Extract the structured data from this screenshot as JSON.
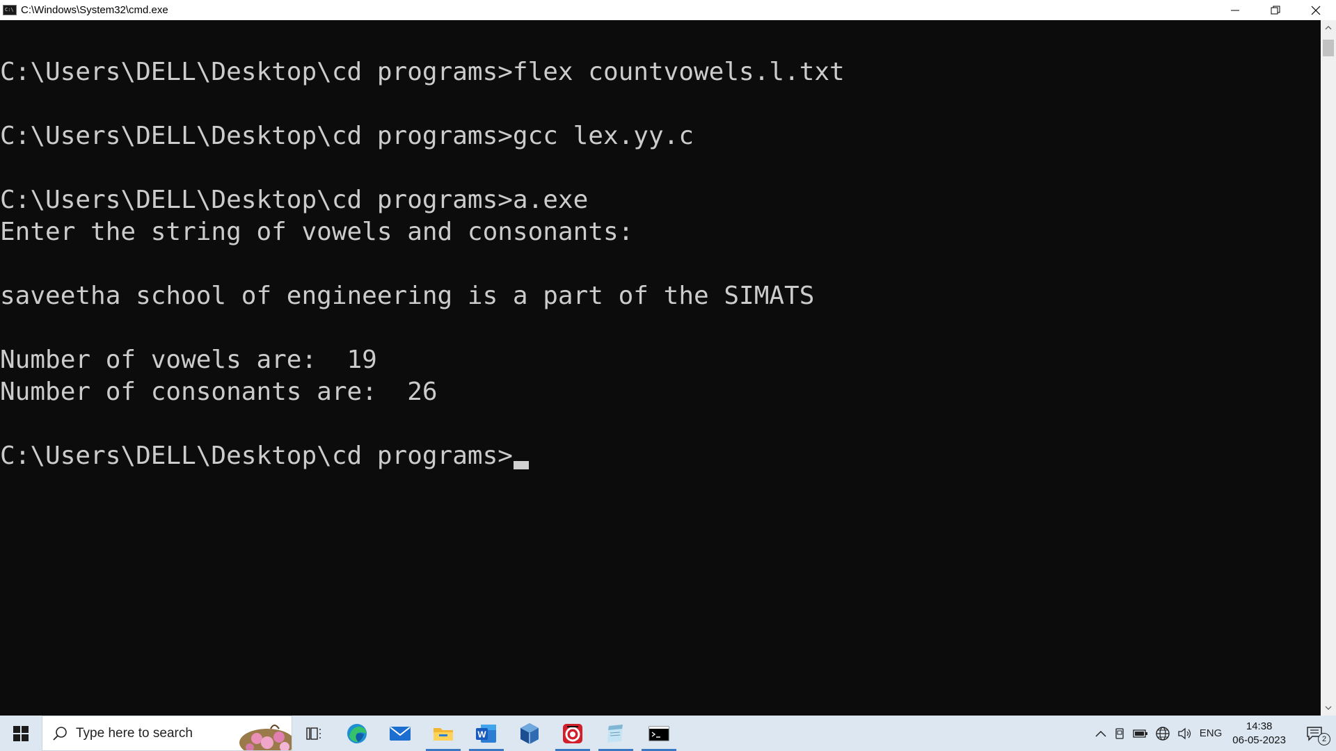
{
  "window": {
    "title": "C:\\Windows\\System32\\cmd.exe",
    "minimize_glyph": "—",
    "restore_glyph": "❐",
    "close_glyph": "✕"
  },
  "console": {
    "lines": [
      "C:\\Users\\DELL\\Desktop\\cd programs>flex countvowels.l.txt",
      "",
      "C:\\Users\\DELL\\Desktop\\cd programs>gcc lex.yy.c",
      "",
      "C:\\Users\\DELL\\Desktop\\cd programs>a.exe",
      "Enter the string of vowels and consonants:",
      "",
      "saveetha school of engineering is a part of the SIMATS",
      "",
      "Number of vowels are:  19",
      "Number of consonants are:  26",
      "",
      "C:\\Users\\DELL\\Desktop\\cd programs>"
    ]
  },
  "taskbar": {
    "search_placeholder": "Type here to search",
    "apps": [
      {
        "name": "task-view-icon",
        "active": false
      },
      {
        "name": "edge-icon",
        "active": false
      },
      {
        "name": "mail-icon",
        "active": false
      },
      {
        "name": "file-explorer-icon",
        "active": true
      },
      {
        "name": "word-icon",
        "active": true
      },
      {
        "name": "virtualbox-icon",
        "active": false
      },
      {
        "name": "app-red-icon",
        "active": true
      },
      {
        "name": "app-notepad-icon",
        "active": true
      },
      {
        "name": "cmd-icon",
        "active": true
      }
    ],
    "tray": {
      "language": "ENG",
      "time": "14:38",
      "date": "06-05-2023",
      "notification_count": "2"
    }
  }
}
